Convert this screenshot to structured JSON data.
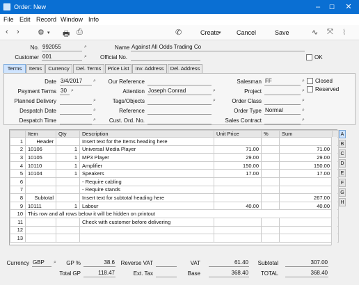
{
  "window": {
    "title": "Order: New",
    "minimize": "–",
    "maximize": "☐",
    "close": "✕"
  },
  "menu": [
    "File",
    "Edit",
    "Record",
    "Window",
    "Info"
  ],
  "toolbar": {
    "create": "Create",
    "cancel": "Cancel",
    "save": "Save"
  },
  "header": {
    "no_label": "No.",
    "no_value": "992055",
    "name_label": "Name",
    "name_value": "Against All Odds Trading Co",
    "customer_label": "Customer",
    "customer_value": "001",
    "official_label": "Official No.",
    "official_value": "",
    "ok_label": "OK"
  },
  "tabs": [
    "Terms",
    "Items",
    "Currency",
    "Del. Terms",
    "Price List",
    "Inv. Address",
    "Del. Address"
  ],
  "terms": {
    "date_label": "Date",
    "date_value": "3/4/2017",
    "our_ref_label": "Our Reference",
    "our_ref_value": "",
    "salesman_label": "Salesman",
    "salesman_value": "FF",
    "closed_label": "Closed",
    "payment_terms_label": "Payment Terms",
    "payment_terms_value": "30",
    "attention_label": "Attention",
    "attention_value": "Joseph Conrad",
    "project_label": "Project",
    "project_value": "",
    "reserved_label": "Reserved",
    "planned_delivery_label": "Planned Delivery",
    "planned_delivery_value": "",
    "tags_label": "Tags/Objects",
    "tags_value": "",
    "order_class_label": "Order Class",
    "order_class_value": "",
    "despatch_date_label": "Despatch Date",
    "despatch_date_value": "",
    "reference_label": "Reference",
    "reference_value": "",
    "order_type_label": "Order Type",
    "order_type_value": "Normal",
    "despatch_time_label": "Despatch Time",
    "despatch_time_value": "",
    "cust_ord_label": "Cust. Ord. No.",
    "cust_ord_value": "",
    "sales_contract_label": "Sales Contract",
    "sales_contract_value": ""
  },
  "grid": {
    "columns": [
      "",
      "Item",
      "Qty",
      "Description",
      "Unit Price",
      "%",
      "Sum"
    ],
    "rows": [
      [
        "1",
        "Header",
        "",
        "Insert text for the Items heading here",
        "",
        "",
        ""
      ],
      [
        "2",
        "10106",
        "1",
        "Universal Media Player",
        "71.00",
        "",
        "71.00"
      ],
      [
        "3",
        "10105",
        "1",
        "MP3 Player",
        "29.00",
        "",
        "29.00"
      ],
      [
        "4",
        "10110",
        "1",
        "Amplifier",
        "150.00",
        "",
        "150.00"
      ],
      [
        "5",
        "10104",
        "1",
        "Speakers",
        "17.00",
        "",
        "17.00"
      ],
      [
        "6",
        "",
        "",
        "- Require cabling",
        "",
        "",
        ""
      ],
      [
        "7",
        "",
        "",
        "- Require stands",
        "",
        "",
        ""
      ],
      [
        "8",
        "Subtotal",
        "",
        "Insert text for subtotal heading here",
        "",
        "",
        "267.00"
      ],
      [
        "9",
        "10111",
        "1",
        "Labour",
        "40.00",
        "",
        "40.00"
      ],
      [
        "10",
        "",
        "",
        "",
        "",
        "",
        ""
      ],
      [
        "11",
        "",
        "",
        "Check with customer before delivering",
        "",
        "",
        ""
      ],
      [
        "12",
        "",
        "",
        "",
        "",
        "",
        ""
      ],
      [
        "13",
        "",
        "",
        "",
        "",
        "",
        ""
      ]
    ],
    "row10_note": "This row and all rows below it will be hidden on printout",
    "side_tabs": [
      "A",
      "B",
      "C",
      "D",
      "E",
      "F",
      "G",
      "H"
    ]
  },
  "footer": {
    "currency_label": "Currency",
    "currency_value": "GBP",
    "gp_pct_label": "GP %",
    "gp_pct_value": "38.6",
    "reverse_vat_label": "Reverse VAT",
    "reverse_vat_value": "",
    "vat_label": "VAT",
    "vat_value": "61.40",
    "subtotal_label": "Subtotal",
    "subtotal_value": "307.00",
    "total_gp_label": "Total GP",
    "total_gp_value": "118.47",
    "ext_tax_label": "Ext. Tax",
    "ext_tax_value": "",
    "base_label": "Base",
    "base_value": "368.40",
    "total_label": "TOTAL",
    "total_value": "368.40"
  }
}
